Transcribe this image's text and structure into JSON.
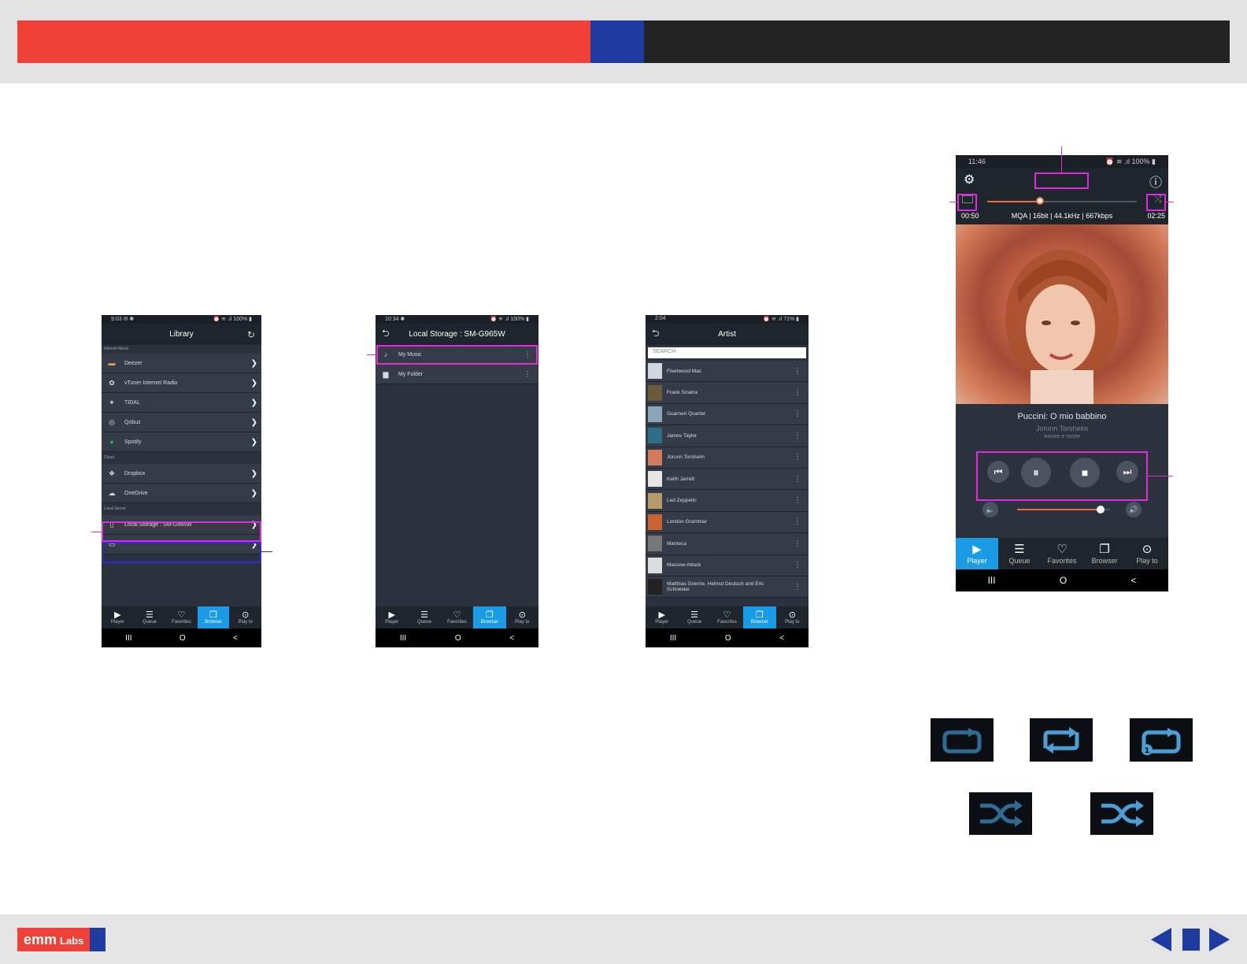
{
  "header": {
    "colors": {
      "red": "#ef4137",
      "blue": "#1f3aa0",
      "dark": "#232323"
    }
  },
  "phone1": {
    "status_left": "9:03 ✉ ✱",
    "status_right": "⏰ ≋ .ıl 100% ▮",
    "title": "Library",
    "refresh_icon": "↻",
    "sections": {
      "internet": "Internet Music",
      "cloud": "Cloud",
      "local": "Local Server"
    },
    "internet_items": [
      {
        "label": "Deezer",
        "icon": "deezer-icon"
      },
      {
        "label": "vTuner Internet Radio",
        "icon": "vtuner-icon"
      },
      {
        "label": "TIDAL",
        "icon": "tidal-icon"
      },
      {
        "label": "Qobuz",
        "icon": "qobuz-icon"
      },
      {
        "label": "Spotify",
        "icon": "spotify-icon"
      }
    ],
    "cloud_items": [
      {
        "label": "Dropbox",
        "icon": "dropbox-icon"
      },
      {
        "label": "OneDrive",
        "icon": "onedrive-icon"
      }
    ],
    "local_items": [
      {
        "label": "Local Storage : SM-G965W",
        "icon": "phone-icon"
      },
      {
        "label": "",
        "icon": "server-icon"
      }
    ],
    "chevron": "❯"
  },
  "phone2": {
    "status_left": "10:34 ✱",
    "status_right": "⏰ ≋ .ıl 100% ▮",
    "title": "Local Storage : SM-G965W",
    "back_icon": "⮌",
    "items": [
      {
        "label": "My Music",
        "icon": "music-note-icon"
      },
      {
        "label": "My Folder",
        "icon": "folder-icon"
      }
    ],
    "kebab": "⋮"
  },
  "phone3": {
    "status_left": "2:04",
    "status_right": "⏰ ≋ .ıl 71% ▮",
    "title": "Artist",
    "back_icon": "⮌",
    "search_placeholder": "SEARCH",
    "artists": [
      "Fleetwood Mac",
      "Frank Sinatra",
      "Guarneri Quartet",
      "James Taylor",
      "Jorunn Torsheim",
      "Keith Jarrett",
      "Led Zeppelin",
      "London Grammar",
      "Manteca",
      "Massive Attack",
      "Matthias Goerne, Helmut Deutsch and Eric Schneider"
    ]
  },
  "tabs": [
    "Player",
    "Queue",
    "Favorites",
    "Browser",
    "Play to"
  ],
  "tab_icons": [
    "▶",
    "☰",
    "♡",
    "❐",
    "⊙"
  ],
  "sysnav": [
    "III",
    "O",
    "<"
  ],
  "player": {
    "status_left": "11:46",
    "status_right": "⏰ ≋ .ıl 100% ▮",
    "gear_icon": "⚙",
    "info_icon": "ⓘ",
    "elapsed": "00:50",
    "total": "02:25",
    "format": "MQA | 16bit | 44.1kHz | 667kbps",
    "progress": 0.35,
    "volume": 0.9,
    "track_title": "Puccini: O mio babbino",
    "artist": "Jorunn Torsheim",
    "album": "Amore e morte"
  },
  "legend_icons": [
    "repeat-off-icon",
    "repeat-all-icon",
    "repeat-one-icon",
    "shuffle-off-icon",
    "shuffle-on-icon"
  ],
  "footer": {
    "logo_main": "emm",
    "logo_sub": "Labs"
  }
}
